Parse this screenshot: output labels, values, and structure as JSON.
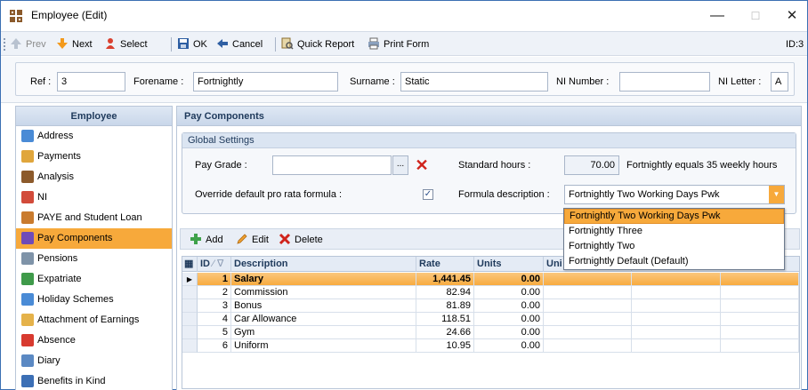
{
  "window": {
    "title": "Employee (Edit)",
    "min_glyph": "—",
    "max_glyph": "☐",
    "close_glyph": "✕"
  },
  "toolbar": {
    "prev": "Prev",
    "next": "Next",
    "select": "Select",
    "ok": "OK",
    "cancel": "Cancel",
    "quick_report": "Quick Report",
    "print_form": "Print Form",
    "id_label": "ID:3"
  },
  "header": {
    "ref_label": "Ref :",
    "ref_value": "3",
    "forename_label": "Forename :",
    "forename_value": "Fortnightly",
    "surname_label": "Surname :",
    "surname_value": "Static",
    "ni_number_label": "NI Number :",
    "ni_number_value": "",
    "ni_letter_label": "NI Letter :",
    "ni_letter_value": "A"
  },
  "sidebar": {
    "title": "Employee",
    "items": [
      {
        "label": "Address",
        "icon": "people-icon",
        "color": "#4a8bd6"
      },
      {
        "label": "Payments",
        "icon": "payments-icon",
        "color": "#e0a63c"
      },
      {
        "label": "Analysis",
        "icon": "analysis-icon",
        "color": "#8c5a2b"
      },
      {
        "label": "NI",
        "icon": "ni-icon",
        "color": "#d24b3a"
      },
      {
        "label": "PAYE and Student Loan",
        "icon": "paye-icon",
        "color": "#c97b2e"
      },
      {
        "label": "Pay Components",
        "icon": "pay-components-icon",
        "color": "#6f4bb8"
      },
      {
        "label": "Pensions",
        "icon": "pensions-icon",
        "color": "#7f93a8"
      },
      {
        "label": "Expatriate",
        "icon": "expatriate-icon",
        "color": "#3f9a4a"
      },
      {
        "label": "Holiday Schemes",
        "icon": "holiday-icon",
        "color": "#4a8bd6"
      },
      {
        "label": "Attachment of Earnings",
        "icon": "attachment-icon",
        "color": "#e5b24a"
      },
      {
        "label": "Absence",
        "icon": "absence-icon",
        "color": "#d83a2f"
      },
      {
        "label": "Diary",
        "icon": "diary-icon",
        "color": "#5b89c3"
      },
      {
        "label": "Benefits in Kind",
        "icon": "benefits-icon",
        "color": "#3c6fb5"
      }
    ],
    "active_index": 5
  },
  "main": {
    "title": "Pay Components",
    "global_settings": {
      "title": "Global Settings",
      "pay_grade_label": "Pay Grade :",
      "pay_grade_value": "",
      "ellipsis_label": "...",
      "standard_hours_label": "Standard hours :",
      "standard_hours_value": "70.00",
      "hours_note": "Fortnightly equals 35 weekly hours",
      "override_label": "Override default pro rata formula :",
      "override_checked": "✓",
      "formula_label": "Formula description :",
      "formula_value": "Fortnightly Two Working Days Pwk"
    },
    "grid_toolbar": {
      "add": "Add",
      "edit": "Edit",
      "delete": "Delete"
    },
    "grid": {
      "columns": [
        "ID",
        "Description",
        "Rate",
        "Units",
        "Uni"
      ],
      "rows": [
        {
          "id": "1",
          "description": "Salary",
          "rate": "1,441.45",
          "units": "0.00"
        },
        {
          "id": "2",
          "description": "Commission",
          "rate": "82.94",
          "units": "0.00"
        },
        {
          "id": "3",
          "description": "Bonus",
          "rate": "81.89",
          "units": "0.00"
        },
        {
          "id": "4",
          "description": "Car Allowance",
          "rate": "118.51",
          "units": "0.00"
        },
        {
          "id": "5",
          "description": "Gym",
          "rate": "24.66",
          "units": "0.00"
        },
        {
          "id": "6",
          "description": "Uniform",
          "rate": "10.95",
          "units": "0.00"
        }
      ],
      "selected_row_marker": "▶"
    },
    "formula_dropdown": {
      "options": [
        "Fortnightly Two Working Days Pwk",
        "Fortnightly Three",
        "Fortnightly Two",
        "Fortnightly Default (Default)"
      ],
      "highlighted_index": 0
    }
  }
}
